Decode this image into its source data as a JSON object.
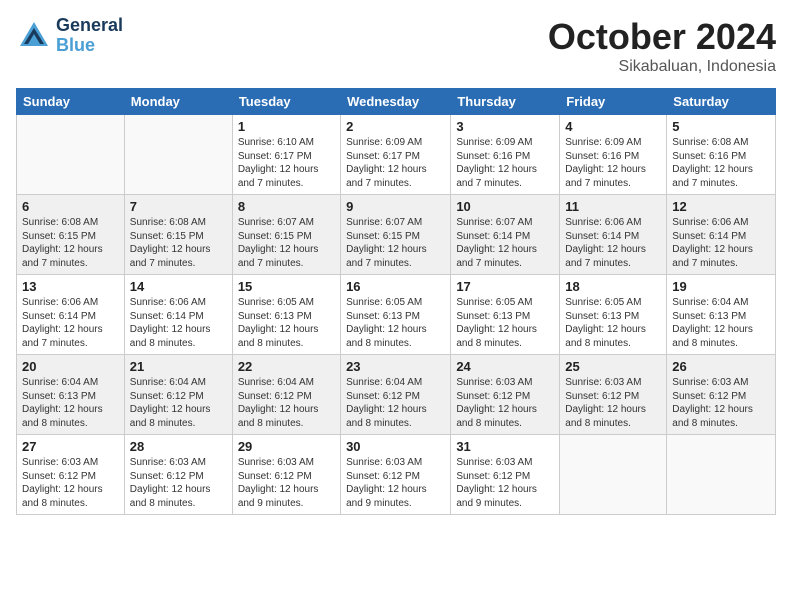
{
  "header": {
    "logo_general": "General",
    "logo_blue": "Blue",
    "title": "October 2024",
    "subtitle": "Sikabaluan, Indonesia"
  },
  "weekdays": [
    "Sunday",
    "Monday",
    "Tuesday",
    "Wednesday",
    "Thursday",
    "Friday",
    "Saturday"
  ],
  "weeks": [
    [
      {
        "day": "",
        "info": ""
      },
      {
        "day": "",
        "info": ""
      },
      {
        "day": "1",
        "info": "Sunrise: 6:10 AM\nSunset: 6:17 PM\nDaylight: 12 hours\nand 7 minutes."
      },
      {
        "day": "2",
        "info": "Sunrise: 6:09 AM\nSunset: 6:17 PM\nDaylight: 12 hours\nand 7 minutes."
      },
      {
        "day": "3",
        "info": "Sunrise: 6:09 AM\nSunset: 6:16 PM\nDaylight: 12 hours\nand 7 minutes."
      },
      {
        "day": "4",
        "info": "Sunrise: 6:09 AM\nSunset: 6:16 PM\nDaylight: 12 hours\nand 7 minutes."
      },
      {
        "day": "5",
        "info": "Sunrise: 6:08 AM\nSunset: 6:16 PM\nDaylight: 12 hours\nand 7 minutes."
      }
    ],
    [
      {
        "day": "6",
        "info": "Sunrise: 6:08 AM\nSunset: 6:15 PM\nDaylight: 12 hours\nand 7 minutes."
      },
      {
        "day": "7",
        "info": "Sunrise: 6:08 AM\nSunset: 6:15 PM\nDaylight: 12 hours\nand 7 minutes."
      },
      {
        "day": "8",
        "info": "Sunrise: 6:07 AM\nSunset: 6:15 PM\nDaylight: 12 hours\nand 7 minutes."
      },
      {
        "day": "9",
        "info": "Sunrise: 6:07 AM\nSunset: 6:15 PM\nDaylight: 12 hours\nand 7 minutes."
      },
      {
        "day": "10",
        "info": "Sunrise: 6:07 AM\nSunset: 6:14 PM\nDaylight: 12 hours\nand 7 minutes."
      },
      {
        "day": "11",
        "info": "Sunrise: 6:06 AM\nSunset: 6:14 PM\nDaylight: 12 hours\nand 7 minutes."
      },
      {
        "day": "12",
        "info": "Sunrise: 6:06 AM\nSunset: 6:14 PM\nDaylight: 12 hours\nand 7 minutes."
      }
    ],
    [
      {
        "day": "13",
        "info": "Sunrise: 6:06 AM\nSunset: 6:14 PM\nDaylight: 12 hours\nand 7 minutes."
      },
      {
        "day": "14",
        "info": "Sunrise: 6:06 AM\nSunset: 6:14 PM\nDaylight: 12 hours\nand 8 minutes."
      },
      {
        "day": "15",
        "info": "Sunrise: 6:05 AM\nSunset: 6:13 PM\nDaylight: 12 hours\nand 8 minutes."
      },
      {
        "day": "16",
        "info": "Sunrise: 6:05 AM\nSunset: 6:13 PM\nDaylight: 12 hours\nand 8 minutes."
      },
      {
        "day": "17",
        "info": "Sunrise: 6:05 AM\nSunset: 6:13 PM\nDaylight: 12 hours\nand 8 minutes."
      },
      {
        "day": "18",
        "info": "Sunrise: 6:05 AM\nSunset: 6:13 PM\nDaylight: 12 hours\nand 8 minutes."
      },
      {
        "day": "19",
        "info": "Sunrise: 6:04 AM\nSunset: 6:13 PM\nDaylight: 12 hours\nand 8 minutes."
      }
    ],
    [
      {
        "day": "20",
        "info": "Sunrise: 6:04 AM\nSunset: 6:13 PM\nDaylight: 12 hours\nand 8 minutes."
      },
      {
        "day": "21",
        "info": "Sunrise: 6:04 AM\nSunset: 6:12 PM\nDaylight: 12 hours\nand 8 minutes."
      },
      {
        "day": "22",
        "info": "Sunrise: 6:04 AM\nSunset: 6:12 PM\nDaylight: 12 hours\nand 8 minutes."
      },
      {
        "day": "23",
        "info": "Sunrise: 6:04 AM\nSunset: 6:12 PM\nDaylight: 12 hours\nand 8 minutes."
      },
      {
        "day": "24",
        "info": "Sunrise: 6:03 AM\nSunset: 6:12 PM\nDaylight: 12 hours\nand 8 minutes."
      },
      {
        "day": "25",
        "info": "Sunrise: 6:03 AM\nSunset: 6:12 PM\nDaylight: 12 hours\nand 8 minutes."
      },
      {
        "day": "26",
        "info": "Sunrise: 6:03 AM\nSunset: 6:12 PM\nDaylight: 12 hours\nand 8 minutes."
      }
    ],
    [
      {
        "day": "27",
        "info": "Sunrise: 6:03 AM\nSunset: 6:12 PM\nDaylight: 12 hours\nand 8 minutes."
      },
      {
        "day": "28",
        "info": "Sunrise: 6:03 AM\nSunset: 6:12 PM\nDaylight: 12 hours\nand 8 minutes."
      },
      {
        "day": "29",
        "info": "Sunrise: 6:03 AM\nSunset: 6:12 PM\nDaylight: 12 hours\nand 9 minutes."
      },
      {
        "day": "30",
        "info": "Sunrise: 6:03 AM\nSunset: 6:12 PM\nDaylight: 12 hours\nand 9 minutes."
      },
      {
        "day": "31",
        "info": "Sunrise: 6:03 AM\nSunset: 6:12 PM\nDaylight: 12 hours\nand 9 minutes."
      },
      {
        "day": "",
        "info": ""
      },
      {
        "day": "",
        "info": ""
      }
    ]
  ],
  "row_shades": [
    false,
    true,
    false,
    true,
    false
  ]
}
